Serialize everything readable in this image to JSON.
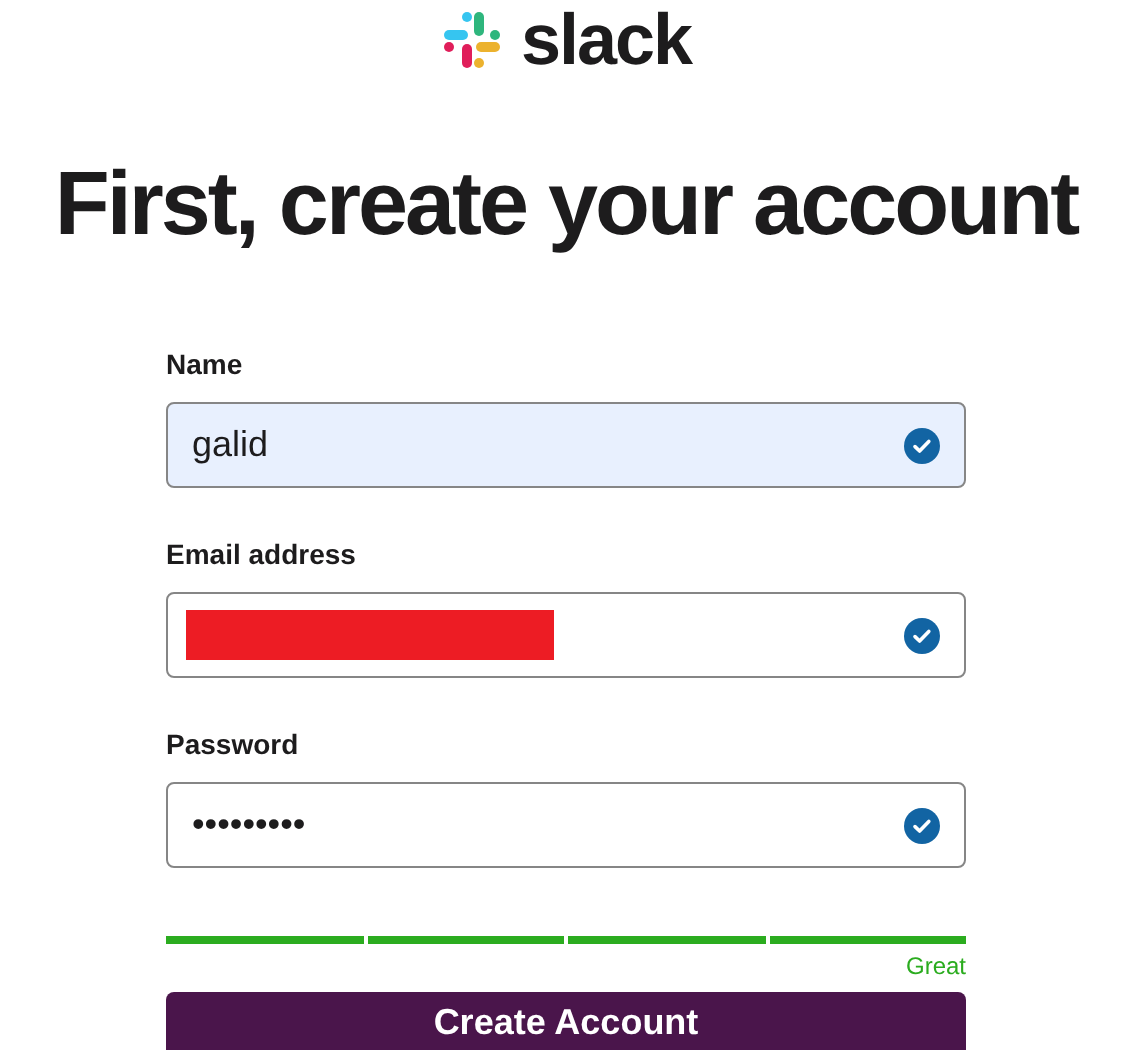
{
  "logo": {
    "wordmark": "slack"
  },
  "heading": "First, create your account",
  "fields": [
    {
      "label": "Name",
      "value": "galid",
      "filled": true,
      "redacted": false,
      "valid": true
    },
    {
      "label": "Email address",
      "filled": false,
      "redacted": true,
      "valid": true
    },
    {
      "label": "Password",
      "value": "•••••••••",
      "filled": false,
      "redacted": false,
      "valid": true
    }
  ],
  "strength": {
    "segments": [
      {
        "on": true
      },
      {
        "on": true
      },
      {
        "on": true
      },
      {
        "on": true
      }
    ],
    "label": "Great"
  },
  "button": "Create Account"
}
